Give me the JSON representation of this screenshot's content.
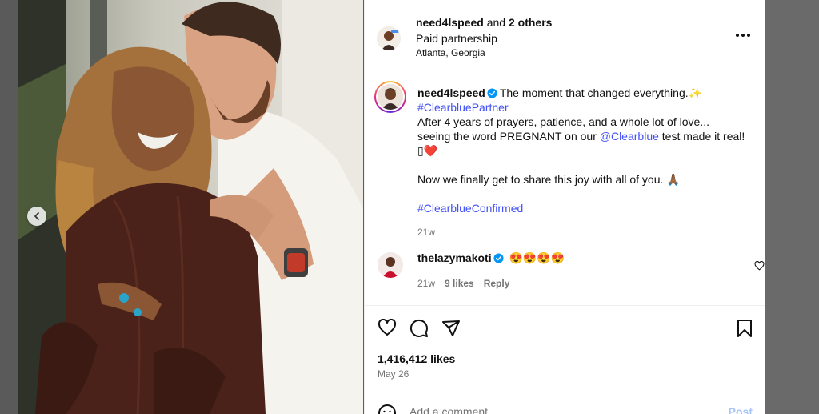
{
  "header": {
    "username": "need4lspeed",
    "and_text": "and",
    "others": "2 others",
    "partnership": "Paid partnership",
    "location": "Atlanta, Georgia"
  },
  "caption": {
    "username": "need4lspeed",
    "line1": "The moment that changed everything.",
    "sparkle": "✨",
    "hashtag1": "#ClearbluePartner",
    "line2": "After 4 years of prayers, patience, and a whole lot of love...",
    "line3a": "seeing the word PREGNANT on our",
    "mention": "@Clearblue",
    "line3b": "test made it real!",
    "line3c": "▯❤️",
    "line4": "Now we finally get to share this joy with all of you.",
    "line4_emoji": "🙏🏾",
    "hashtag2": "#ClearblueConfirmed",
    "time": "21w"
  },
  "comment": {
    "username": "thelazymakoti",
    "text": "😍😍😍😍",
    "time": "21w",
    "likes": "9 likes",
    "reply": "Reply"
  },
  "actions": {
    "likes": "1,416,412 likes",
    "date": "May 26"
  },
  "add_comment": {
    "placeholder": "Add a comment...",
    "post": "Post"
  },
  "colors": {
    "link": "#4150f7",
    "verified": "#0095f6",
    "post_button": "#a7c5f9",
    "muted": "#737373"
  }
}
